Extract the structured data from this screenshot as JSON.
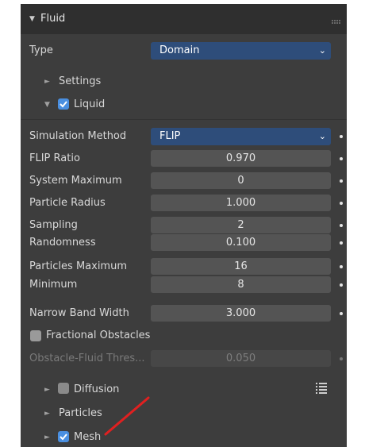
{
  "panel": {
    "title": "Fluid",
    "type_label": "Type",
    "type_value": "Domain"
  },
  "subpanels": {
    "settings": "Settings",
    "liquid": "Liquid",
    "diffusion": "Diffusion",
    "particles": "Particles",
    "mesh": "Mesh"
  },
  "liquid": {
    "simulation_method_label": "Simulation Method",
    "simulation_method_value": "FLIP",
    "flip_ratio_label": "FLIP Ratio",
    "flip_ratio_value": "0.970",
    "system_maximum_label": "System Maximum",
    "system_maximum_value": "0",
    "particle_radius_label": "Particle Radius",
    "particle_radius_value": "1.000",
    "sampling_label": "Sampling",
    "sampling_value": "2",
    "randomness_label": "Randomness",
    "randomness_value": "0.100",
    "particles_maximum_label": "Particles Maximum",
    "particles_maximum_value": "16",
    "minimum_label": "Minimum",
    "minimum_value": "8",
    "narrow_band_width_label": "Narrow Band Width",
    "narrow_band_width_value": "3.000",
    "fractional_obstacles_label": "Fractional Obstacles",
    "obstacle_threshold_label": "Obstacle-Fluid Thres...",
    "obstacle_threshold_value": "0.050"
  },
  "icons": {
    "collapse": "triangle-down-icon",
    "expand": "triangle-right-icon",
    "drag": "drag-handle-icon",
    "list": "list-icon",
    "checkbox": "checkmark-icon",
    "dropdown": "chevron-down-icon",
    "keyframe": "keyframe-dot-icon"
  },
  "colors": {
    "panel_bg": "#3d3d3d",
    "header_bg": "#2f2f2f",
    "field_bg": "#545454",
    "dropdown_bg": "#2e4d7a",
    "checkbox_on": "#4a8fe0",
    "annotation_arrow": "#e02020"
  }
}
